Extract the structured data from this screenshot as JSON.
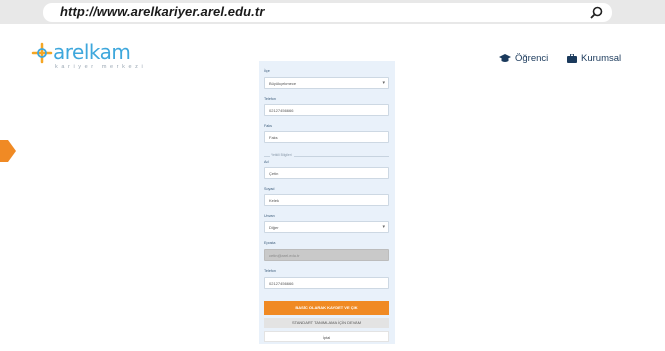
{
  "browser": {
    "url": "http://www.arelkariyer.arel.edu.tr"
  },
  "header": {
    "logo_text_main": "arelkam",
    "logo_text_sub": "kariyer merkezi",
    "nav": [
      {
        "label": "Öğrenci",
        "icon": "graduation-cap-icon"
      },
      {
        "label": "Kurumsal",
        "icon": "briefcase-icon"
      }
    ]
  },
  "form": {
    "fields": [
      {
        "label": "İlçe",
        "value": "Büyükçekmece",
        "type": "select"
      },
      {
        "label": "Telefon",
        "value": "02127456666",
        "type": "text"
      },
      {
        "label": "Faks",
        "value": "Faks",
        "type": "text"
      },
      {
        "label": "Ad",
        "value": "Çetin",
        "type": "text"
      },
      {
        "label": "Soyad",
        "value": "Kelek",
        "type": "text"
      },
      {
        "label": "Unvan",
        "value": "Diğer",
        "type": "select"
      },
      {
        "label": "Eposta",
        "value": "cetin@arel.edu.tr",
        "type": "disabled"
      },
      {
        "label": "Telefon",
        "value": "02127456666",
        "type": "text"
      }
    ],
    "section_label": "Yetkili Bilgileri",
    "buttons": {
      "primary": "BASİC OLARAK KAYDET VE ÇIK",
      "secondary": "STANDART TANIMLAMA İÇİN DEVAM",
      "cancel": "İptal"
    }
  },
  "colors": {
    "accent": "#f08a24",
    "brand_blue": "#3ea7dc",
    "panel_bg": "#e9f1fa"
  }
}
